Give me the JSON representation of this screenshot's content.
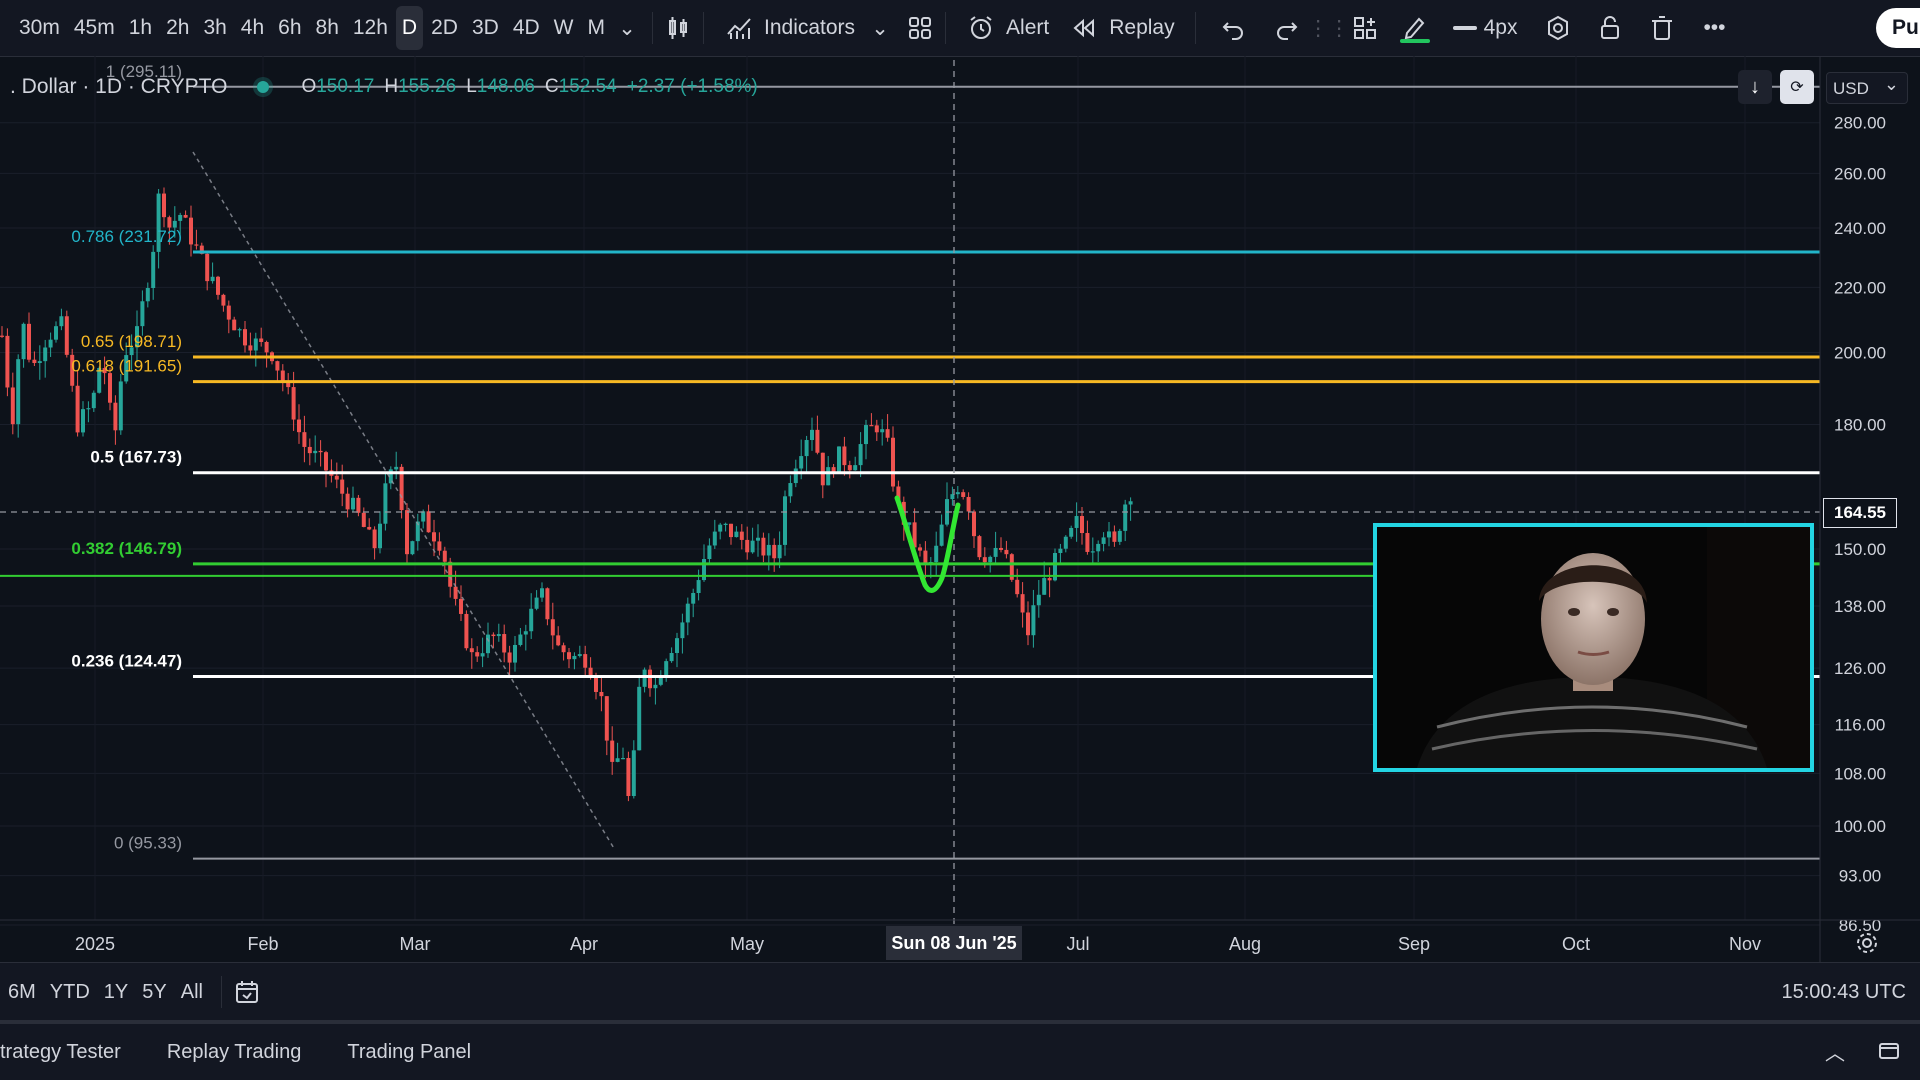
{
  "toolbar": {
    "intervals": [
      "30m",
      "45m",
      "1h",
      "2h",
      "3h",
      "4h",
      "6h",
      "8h",
      "12h",
      "D",
      "2D",
      "3D",
      "4D",
      "W",
      "M"
    ],
    "active_interval": "D",
    "indicators_label": "Indicators",
    "alert_label": "Alert",
    "replay_label": "Replay",
    "line_width_label": "4px",
    "publish_label": "Pu",
    "pen_color": "#22c55e"
  },
  "legend": {
    "symbol": ". Dollar · 1D · CRYPTO",
    "open_key": "O",
    "open": "150.17",
    "high_key": "H",
    "high": "155.26",
    "low_key": "L",
    "low": "148.06",
    "close_key": "C",
    "close": "152.54",
    "change": "+2.37 (+1.58%)"
  },
  "price_axis": {
    "currency": "USD",
    "current_price": "164.55",
    "ticks": [
      "280.00",
      "260.00",
      "240.00",
      "220.00",
      "200.00",
      "180.00",
      "150.00",
      "138.00",
      "126.00",
      "116.00",
      "108.00",
      "100.00",
      "93.00",
      "86.50"
    ]
  },
  "time_axis": {
    "labels": [
      "2025",
      "Feb",
      "Mar",
      "Apr",
      "May",
      "Jul",
      "Aug",
      "Sep",
      "Oct",
      "Nov"
    ],
    "crosshair_date": "Sun 08 Jun '25"
  },
  "fib_levels": [
    {
      "label": "1 (295.11)",
      "price": 295.11,
      "color": "#9598a1"
    },
    {
      "label": "0.786 (231.72)",
      "price": 231.72,
      "color": "#22b5c9"
    },
    {
      "label": "0.65 (198.71)",
      "price": 198.71,
      "color": "#f7b924"
    },
    {
      "label": "0.618 (191.65)",
      "price": 191.65,
      "color": "#f7b924"
    },
    {
      "label": "0.5 (167.73)",
      "price": 167.73,
      "color": "#ffffff"
    },
    {
      "label": "0.382 (146.79)",
      "price": 146.79,
      "color": "#32cd32"
    },
    {
      "label": "0.236 (124.47)",
      "price": 124.47,
      "color": "#ffffff"
    },
    {
      "label": "0 (95.33)",
      "price": 95.33,
      "color": "#9598a1"
    }
  ],
  "colors": {
    "up": "#26a69a",
    "down": "#ef5350",
    "webcam_border": "#23d5e3",
    "drawing": "#32e632"
  },
  "range_bar": {
    "ranges": [
      "6M",
      "YTD",
      "1Y",
      "5Y",
      "All"
    ],
    "clock": "15:00:43 UTC"
  },
  "bottom_panel": {
    "tabs": [
      "trategy Tester",
      "Replay Trading",
      "Trading Panel"
    ]
  }
}
